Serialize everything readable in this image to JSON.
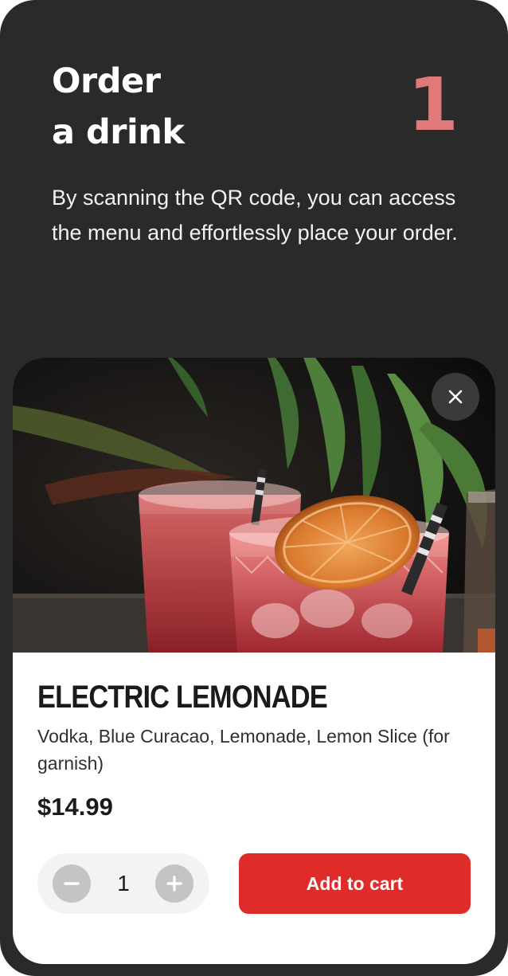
{
  "step": {
    "title_line1": "Order",
    "title_line2": "a drink",
    "number": "1",
    "description": "By scanning the QR code, you can access the menu and effortlessly place your order."
  },
  "product": {
    "name": "ELECTRIC LEMONADE",
    "description": "Vodka, Blue Curacao, Lemonade, Lemon Slice (for garnish)",
    "price": "$14.99",
    "quantity": "1",
    "add_to_cart_label": "Add to cart",
    "image": "cocktail-photo"
  },
  "icons": {
    "close": "close-icon",
    "minus": "minus-icon",
    "plus": "plus-icon"
  },
  "colors": {
    "background": "#2a2a2a",
    "step_number": "#e07a7a",
    "accent": "#e02b2b",
    "stepper_bg": "#f3f3f3",
    "stepper_button": "#c4c4c4"
  }
}
